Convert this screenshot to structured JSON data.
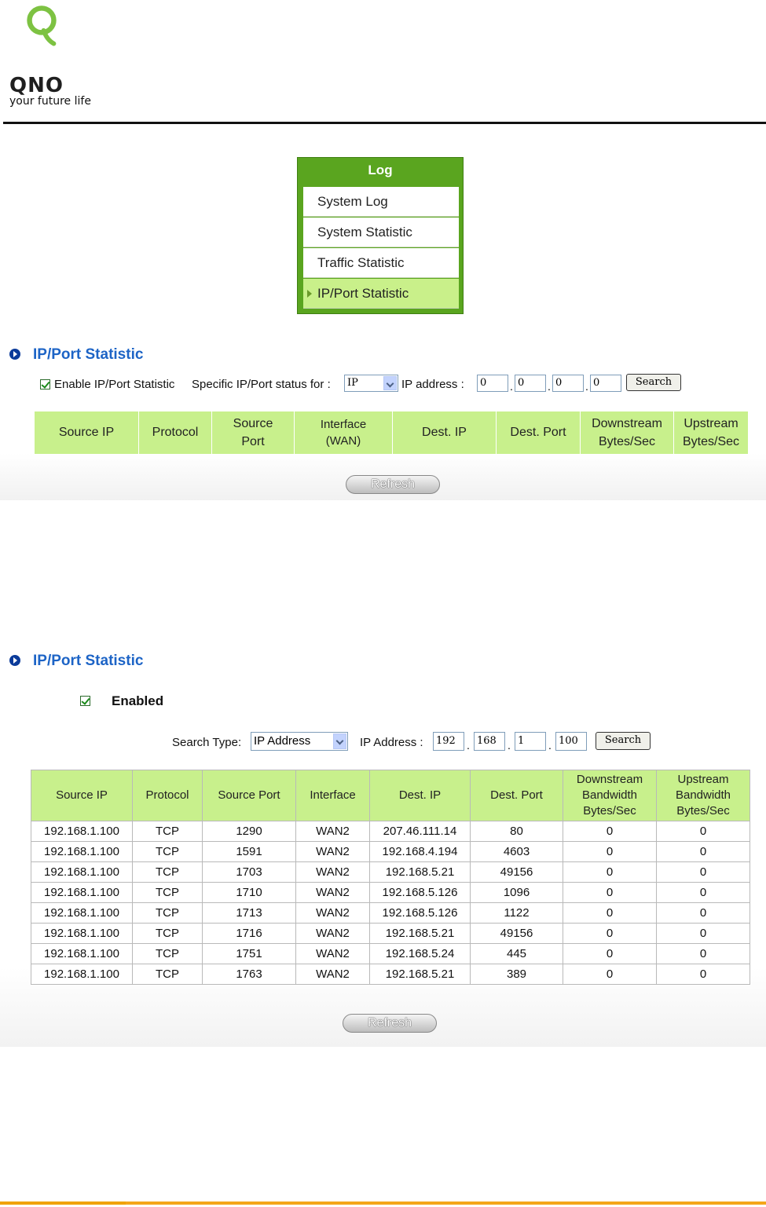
{
  "logo": {
    "wordmark": "QNO",
    "tagline": "your future life",
    "brand_color": "#7dc242"
  },
  "log_menu": {
    "title": "Log",
    "items": [
      {
        "label": "System Log",
        "active": false
      },
      {
        "label": "System Statistic",
        "active": false
      },
      {
        "label": "Traffic Statistic",
        "active": false
      },
      {
        "label": "IP/Port Statistic",
        "active": true
      }
    ]
  },
  "panel1": {
    "title": "IP/Port Statistic",
    "enable_label": "Enable IP/Port Statistic",
    "specific_label": "Specific IP/Port status for :",
    "type_value": "IP",
    "ip_label": "IP address :",
    "ip": [
      "0",
      "0",
      "0",
      "0"
    ],
    "search_label": "Search",
    "headers": [
      "Source IP",
      "Protocol",
      "Source Port",
      "Interface (WAN)",
      "Dest. IP",
      "Dest. Port",
      "Downstream Bytes/Sec",
      "Upstream Bytes/Sec"
    ],
    "refresh_label": "Refresh"
  },
  "panel2": {
    "title": "IP/Port Statistic",
    "enabled_label": "Enabled",
    "search_type_label": "Search Type:",
    "search_type_value": "IP Address",
    "ip_label": "IP Address :",
    "ip": [
      "192",
      "168",
      "1",
      "100"
    ],
    "search_label": "Search",
    "headers": [
      "Source IP",
      "Protocol",
      "Source Port",
      "Interface",
      "Dest. IP",
      "Dest. Port",
      "Downstream Bandwidth Bytes/Sec",
      "Upstream Bandwidth Bytes/Sec"
    ],
    "rows": [
      [
        "192.168.1.100",
        "TCP",
        "1290",
        "WAN2",
        "207.46.111.14",
        "80",
        "0",
        "0"
      ],
      [
        "192.168.1.100",
        "TCP",
        "1591",
        "WAN2",
        "192.168.4.194",
        "4603",
        "0",
        "0"
      ],
      [
        "192.168.1.100",
        "TCP",
        "1703",
        "WAN2",
        "192.168.5.21",
        "49156",
        "0",
        "0"
      ],
      [
        "192.168.1.100",
        "TCP",
        "1710",
        "WAN2",
        "192.168.5.126",
        "1096",
        "0",
        "0"
      ],
      [
        "192.168.1.100",
        "TCP",
        "1713",
        "WAN2",
        "192.168.5.126",
        "1122",
        "0",
        "0"
      ],
      [
        "192.168.1.100",
        "TCP",
        "1716",
        "WAN2",
        "192.168.5.21",
        "49156",
        "0",
        "0"
      ],
      [
        "192.168.1.100",
        "TCP",
        "1751",
        "WAN2",
        "192.168.5.24",
        "445",
        "0",
        "0"
      ],
      [
        "192.168.1.100",
        "TCP",
        "1763",
        "WAN2",
        "192.168.5.21",
        "389",
        "0",
        "0"
      ]
    ],
    "refresh_label": "Refresh"
  },
  "colors": {
    "header_green": "#c8f08c",
    "menu_green": "#5aa51f",
    "title_blue": "#1d64c6",
    "footer_orange": "#f4a61a"
  }
}
